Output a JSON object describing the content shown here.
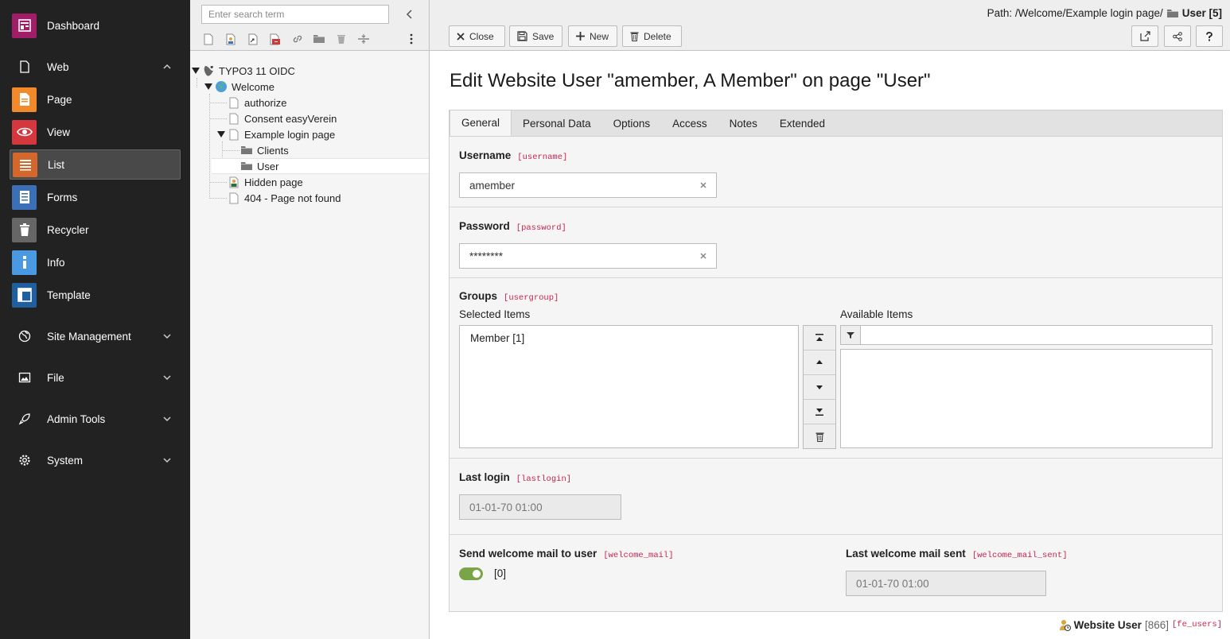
{
  "modules": {
    "items": [
      {
        "label": "Dashboard",
        "icon": "dashboard-icon",
        "color": "#9f1e67"
      },
      {
        "label": "Page",
        "icon": "page-module-icon",
        "color": "#f28a2b"
      },
      {
        "label": "View",
        "icon": "eye-icon",
        "color": "#d5373f"
      },
      {
        "label": "List",
        "icon": "list-icon",
        "color": "#d4682c"
      },
      {
        "label": "Forms",
        "icon": "forms-icon",
        "color": "#3b6fb6"
      },
      {
        "label": "Recycler",
        "icon": "trash-icon",
        "color": "#666666"
      },
      {
        "label": "Info",
        "icon": "info-icon",
        "color": "#4a9ae3"
      },
      {
        "label": "Template",
        "icon": "template-icon",
        "color": "#1f5f9e"
      }
    ],
    "groups": {
      "web": "Web",
      "site": "Site Management",
      "file": "File",
      "admin": "Admin Tools",
      "system": "System"
    }
  },
  "tree": {
    "search_placeholder": "Enter search term",
    "nodes": {
      "root": "TYPO3 11 OIDC",
      "welcome": "Welcome",
      "authorize": "authorize",
      "consent": "Consent easyVerein",
      "example": "Example login page",
      "clients": "Clients",
      "user": "User",
      "hidden": "Hidden page",
      "notfound": "404 - Page not found"
    }
  },
  "header": {
    "path_prefix": "Path: /Welcome/Example login page/",
    "path_current": "User [5]",
    "buttons": {
      "close": "Close",
      "save": "Save",
      "new": "New",
      "delete": "Delete"
    }
  },
  "page_title": "Edit Website User \"amember, A Member\" on page \"User\"",
  "tabs": [
    "General",
    "Personal Data",
    "Options",
    "Access",
    "Notes",
    "Extended"
  ],
  "form": {
    "username": {
      "label": "Username",
      "key": "[username]",
      "value": "amember"
    },
    "password": {
      "label": "Password",
      "key": "[password]",
      "value": "********"
    },
    "groups": {
      "label": "Groups",
      "key": "[usergroup]",
      "selected_label": "Selected Items",
      "available_label": "Available Items",
      "selected": [
        "Member [1]"
      ]
    },
    "lastlogin": {
      "label": "Last login",
      "key": "[lastlogin]",
      "value": "01-01-70 01:00"
    },
    "welcome_mail": {
      "label": "Send welcome mail to user",
      "key": "[welcome_mail]",
      "value": "[0]"
    },
    "welcome_mail_sent": {
      "label": "Last welcome mail sent",
      "key": "[welcome_mail_sent]",
      "value": "01-01-70 01:00"
    }
  },
  "record_footer": {
    "type": "Website User",
    "uid": "[866]",
    "table": "[fe_users]"
  },
  "colors": {
    "toggle_on": "#79a548",
    "field_key": "#c7254e"
  }
}
